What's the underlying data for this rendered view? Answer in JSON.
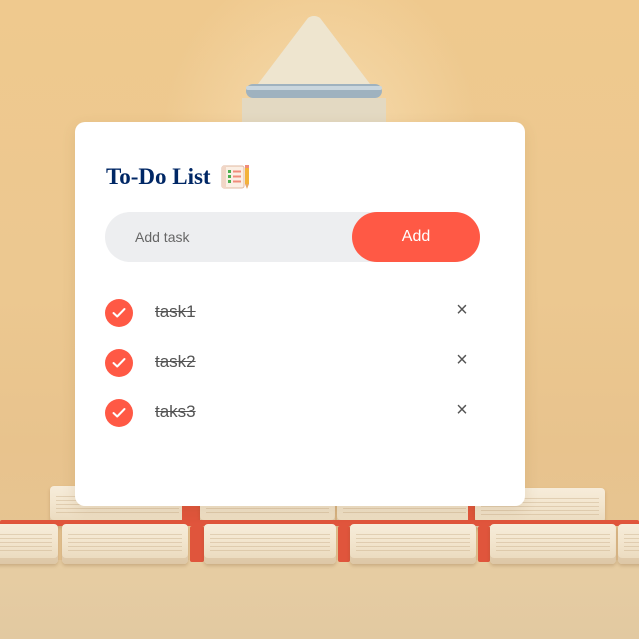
{
  "app": {
    "title": "To-Do List",
    "title_icon": "notepad-checklist-icon"
  },
  "add_task": {
    "placeholder": "Add task",
    "value": "",
    "button_label": "Add"
  },
  "tasks": [
    {
      "label": "task1",
      "completed": true,
      "delete_label": "×"
    },
    {
      "label": "task2",
      "completed": true,
      "delete_label": "×"
    },
    {
      "label": "taks3",
      "completed": true,
      "delete_label": "×"
    }
  ],
  "colors": {
    "accent": "#ff5945",
    "title": "#002765",
    "input_background": "#edeef0",
    "card": "#ffffff"
  }
}
